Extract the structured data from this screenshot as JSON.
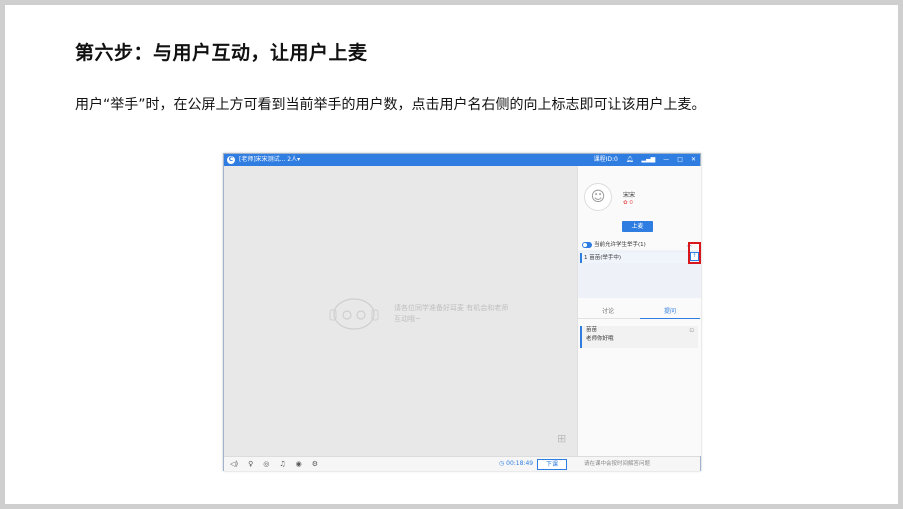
{
  "heading": "第六步：与用户互动，让用户上麦",
  "paragraph": "用户“举手”时，在公屏上方可看到当前举手的用户数，点击用户名右侧的向上标志即可让该用户上麦。",
  "app": {
    "logo": "C",
    "window_title": "[老师]宋宋测试... 2人▾",
    "course_label": "课程ID:0",
    "window_controls": [
      "—",
      "□",
      "✕"
    ],
    "stage_hint": "请各位同学准备好耳麦 有机会和老师互动哦~",
    "grid_icon": "⊞",
    "timer": "◷ 00:18:49",
    "end_button": "下课",
    "chat_placeholder": "请在课中会按时间解答问题",
    "panel": {
      "user_name": "宋宋",
      "flowers": "✿ 0",
      "mic_button": "上麦",
      "allow_hands": "当前允许学生举手(1)",
      "hand_user": "1  苗苗(举手中)",
      "up_icon": "↑",
      "tabs": [
        "讨论",
        "提问"
      ],
      "qa_user": "苗苗",
      "qa_text": "老师你好哦",
      "qa_delete": "⊡"
    },
    "tools": [
      "◁)",
      "♀",
      "◎",
      "♫",
      "◉",
      "⚙"
    ]
  }
}
